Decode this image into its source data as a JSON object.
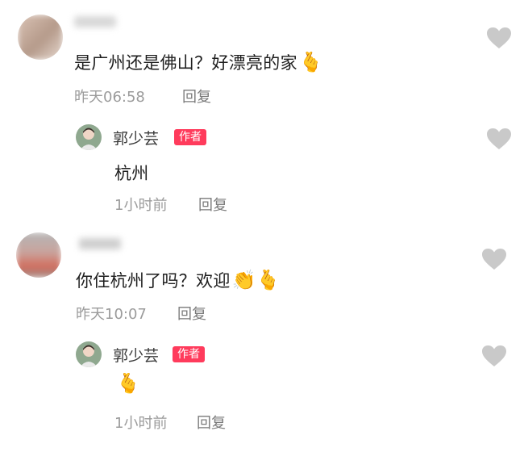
{
  "comments": [
    {
      "text": "是广州还是佛山？好漂亮的家",
      "emoji": "🫰",
      "time": "昨天06:58",
      "reply_label": "回复",
      "reply": {
        "author": "郭少芸",
        "badge": "作者",
        "text": "杭州",
        "time": "1小时前",
        "reply_label": "回复"
      }
    },
    {
      "text": "你住杭州了吗？欢迎",
      "emoji": "👏🫰",
      "time": "昨天10:07",
      "reply_label": "回复",
      "reply": {
        "author": "郭少芸",
        "badge": "作者",
        "emoji": "🫰",
        "time": "1小时前",
        "reply_label": "回复"
      }
    }
  ],
  "icons": {
    "like": "heart-icon"
  },
  "colors": {
    "badge": "#ff3b5c",
    "heart": "#c9c9c9",
    "meta": "#9b9b9b"
  }
}
